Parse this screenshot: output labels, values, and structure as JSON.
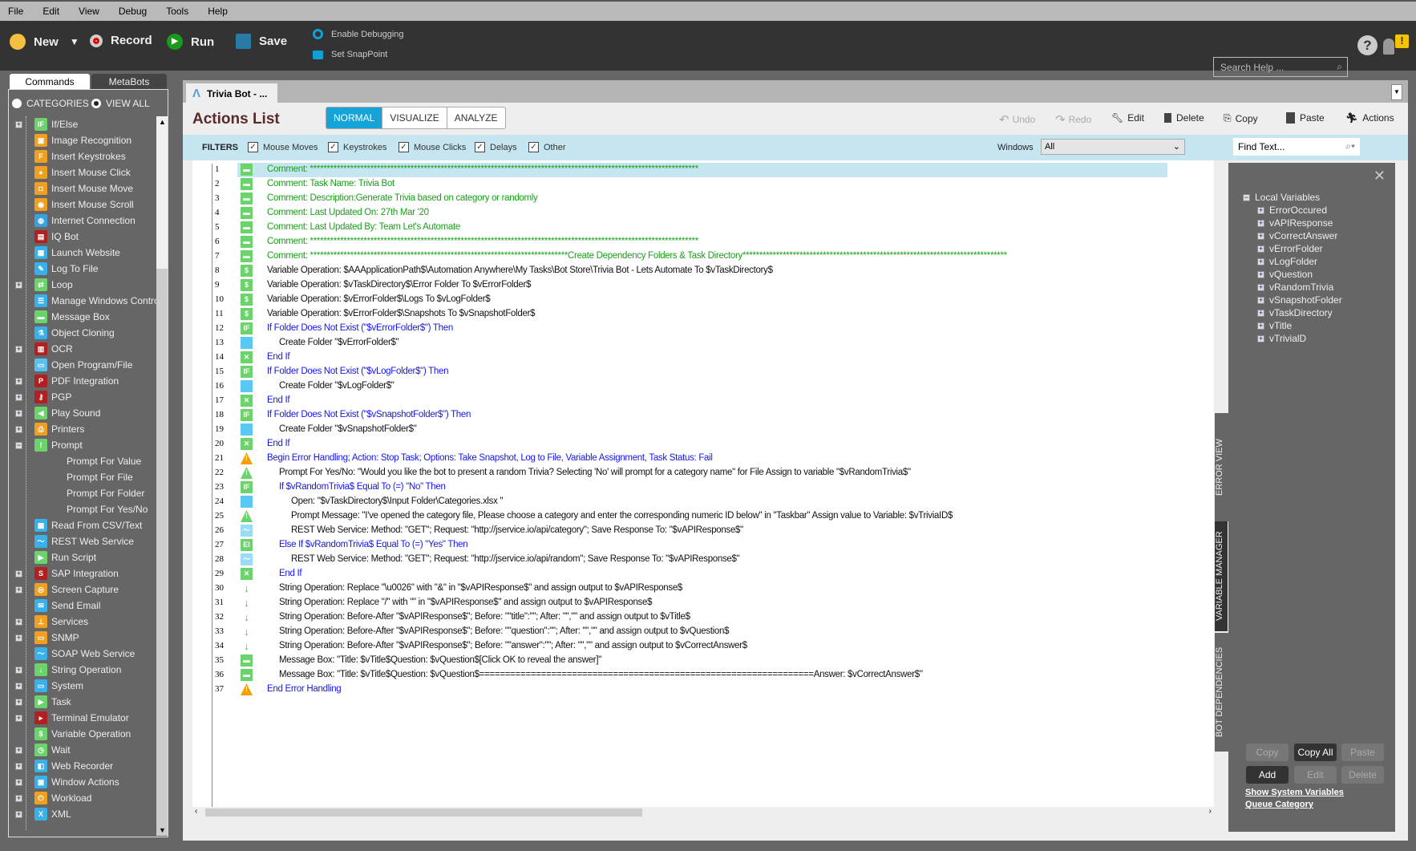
{
  "menu": [
    "File",
    "Edit",
    "View",
    "Debug",
    "Tools",
    "Help"
  ],
  "toolbar": {
    "new": "New",
    "record": "Record",
    "run": "Run",
    "save": "Save",
    "debug": "Enable Debugging",
    "snap": "Set SnapPoint",
    "search_placeholder": "Search Help ..."
  },
  "sidebar": {
    "tabs": [
      "Commands",
      "MetaBots"
    ],
    "categories": "CATEGORIES",
    "view_all": "VIEW ALL",
    "items": [
      {
        "label": "If/Else",
        "exp": "+",
        "icon": "IF",
        "color": "#6cd36c"
      },
      {
        "label": "Image Recognition",
        "icon": "▣",
        "color": "#f0a020"
      },
      {
        "label": "Insert Keystrokes",
        "icon": "F",
        "color": "#f0a020"
      },
      {
        "label": "Insert Mouse Click",
        "icon": "●",
        "color": "#f0a020"
      },
      {
        "label": "Insert Mouse Move",
        "icon": "◘",
        "color": "#f0a020"
      },
      {
        "label": "Insert Mouse Scroll",
        "icon": "◉",
        "color": "#f0a020"
      },
      {
        "label": "Internet Connection",
        "icon": "◍",
        "color": "#3aa0e0"
      },
      {
        "label": "IQ Bot",
        "icon": "▤",
        "color": "#b02020"
      },
      {
        "label": "Launch Website",
        "icon": "▦",
        "color": "#3ab0e8"
      },
      {
        "label": "Log To File",
        "icon": "✎",
        "color": "#3ab0e8"
      },
      {
        "label": "Loop",
        "exp": "+",
        "icon": "⇄",
        "color": "#6cd36c"
      },
      {
        "label": "Manage Windows Controls",
        "icon": "☰",
        "color": "#3ab0e8"
      },
      {
        "label": "Message Box",
        "icon": "▬",
        "color": "#6cd36c"
      },
      {
        "label": "Object Cloning",
        "icon": "⚗",
        "color": "#3ab0e8"
      },
      {
        "label": "OCR",
        "exp": "+",
        "icon": "▥",
        "color": "#b02020"
      },
      {
        "label": "Open Program/File",
        "icon": "▭",
        "color": "#5ac0f0"
      },
      {
        "label": "PDF Integration",
        "exp": "+",
        "icon": "P",
        "color": "#b02020"
      },
      {
        "label": "PGP",
        "exp": "+",
        "icon": "⚷",
        "color": "#b02020"
      },
      {
        "label": "Play Sound",
        "exp": "+",
        "icon": "◀",
        "color": "#6cd36c"
      },
      {
        "label": "Printers",
        "exp": "+",
        "icon": "⎙",
        "color": "#f0a020"
      },
      {
        "label": "Prompt",
        "exp": "−",
        "icon": "!",
        "color": "#6cd36c"
      },
      {
        "label": "Prompt For Value",
        "child": true
      },
      {
        "label": "Prompt For File",
        "child": true
      },
      {
        "label": "Prompt For Folder",
        "child": true
      },
      {
        "label": "Prompt For Yes/No",
        "child": true
      },
      {
        "label": "Read From CSV/Text",
        "icon": "▦",
        "color": "#3ab0e8"
      },
      {
        "label": "REST Web Service",
        "icon": "〜",
        "color": "#3ab0e8"
      },
      {
        "label": "Run Script",
        "icon": "▶",
        "color": "#6cd36c"
      },
      {
        "label": "SAP Integration",
        "exp": "+",
        "icon": "S",
        "color": "#b02020"
      },
      {
        "label": "Screen Capture",
        "exp": "+",
        "icon": "◎",
        "color": "#f0a020"
      },
      {
        "label": "Send Email",
        "icon": "✉",
        "color": "#3ab0e8"
      },
      {
        "label": "Services",
        "exp": "+",
        "icon": "⊥",
        "color": "#f0a020"
      },
      {
        "label": "SNMP",
        "exp": "+",
        "icon": "▭",
        "color": "#f0a020"
      },
      {
        "label": "SOAP Web Service",
        "icon": "〜",
        "color": "#3ab0e8"
      },
      {
        "label": "String Operation",
        "exp": "+",
        "icon": "↓",
        "color": "#6cd36c"
      },
      {
        "label": "System",
        "exp": "+",
        "icon": "▭",
        "color": "#3ab0e8"
      },
      {
        "label": "Task",
        "exp": "+",
        "icon": "▶",
        "color": "#6cd36c"
      },
      {
        "label": "Terminal Emulator",
        "exp": "+",
        "icon": "▸",
        "color": "#b02020"
      },
      {
        "label": "Variable Operation",
        "icon": "$",
        "color": "#6cd36c"
      },
      {
        "label": "Wait",
        "exp": "+",
        "icon": "◷",
        "color": "#6cd36c"
      },
      {
        "label": "Web Recorder",
        "exp": "+",
        "icon": "◧",
        "color": "#3ab0e8"
      },
      {
        "label": "Window Actions",
        "exp": "+",
        "icon": "▣",
        "color": "#3ab0e8"
      },
      {
        "label": "Workload",
        "exp": "+",
        "icon": "⏻",
        "color": "#f0a020"
      },
      {
        "label": "XML",
        "exp": "+",
        "icon": "X",
        "color": "#3ab0e8"
      }
    ]
  },
  "doc_tab": "Trivia Bot - ...",
  "actions": {
    "title": "Actions List",
    "views": [
      "NORMAL",
      "VISUALIZE",
      "ANALYZE"
    ],
    "undo": "Undo",
    "redo": "Redo",
    "edit": "Edit",
    "delete": "Delete",
    "copy": "Copy",
    "paste": "Paste",
    "actions": "Actions"
  },
  "filters": {
    "label": "FILTERS",
    "items": [
      "Mouse Moves",
      "Keystrokes",
      "Mouse Clicks",
      "Delays",
      "Other"
    ],
    "windows_label": "Windows",
    "windows_value": "All",
    "find_placeholder": "Find Text..."
  },
  "lines": [
    {
      "t": "Comment: ********************************************************************************************************************",
      "i": "cm",
      "c": "green",
      "d": 0
    },
    {
      "t": "Comment: Task Name: Trivia Bot",
      "i": "cm",
      "c": "green",
      "d": 0
    },
    {
      "t": "Comment: Description:Generate Trivia based on category or randomly",
      "i": "cm",
      "c": "green",
      "d": 0
    },
    {
      "t": "Comment: Last Updated On: 27th Mar '20",
      "i": "cm",
      "c": "green",
      "d": 0
    },
    {
      "t": "Comment: Last Updated By: Team Let's Automate",
      "i": "cm",
      "c": "green",
      "d": 0
    },
    {
      "t": "Comment: ********************************************************************************************************************",
      "i": "cm",
      "c": "green",
      "d": 0
    },
    {
      "t": "Comment: *****************************************************************************Create Dependency Folders & Task Directory*******************************************************************************",
      "i": "cm",
      "c": "green",
      "d": 0
    },
    {
      "t": "Variable Operation: $AAApplicationPath$\\Automation Anywhere\\My Tasks\\Bot Store\\Trivia Bot - Lets Automate To $vTaskDirectory$",
      "i": "var",
      "c": "black",
      "d": 0
    },
    {
      "t": "Variable Operation: $vTaskDirectory$\\Error Folder To $vErrorFolder$",
      "i": "var",
      "c": "black",
      "d": 0
    },
    {
      "t": "Variable Operation: $vErrorFolder$\\Logs To $vLogFolder$",
      "i": "var",
      "c": "black",
      "d": 0
    },
    {
      "t": "Variable Operation: $vErrorFolder$\\Snapshots To $vSnapshotFolder$",
      "i": "var",
      "c": "black",
      "d": 0
    },
    {
      "t": "If Folder Does Not Exist (\"$vErrorFolder$\")  Then",
      "i": "if",
      "c": "blue",
      "d": 0
    },
    {
      "t": "Create Folder \"$vErrorFolder$\"",
      "i": "fold",
      "c": "black",
      "d": 1
    },
    {
      "t": "End If",
      "i": "endif",
      "c": "blue",
      "d": 0
    },
    {
      "t": "If Folder Does Not Exist (\"$vLogFolder$\")  Then",
      "i": "if",
      "c": "blue",
      "d": 0
    },
    {
      "t": "Create Folder \"$vLogFolder$\"",
      "i": "fold",
      "c": "black",
      "d": 1
    },
    {
      "t": "End If",
      "i": "endif",
      "c": "blue",
      "d": 0
    },
    {
      "t": "If Folder Does Not Exist (\"$vSnapshotFolder$\")  Then",
      "i": "if",
      "c": "blue",
      "d": 0
    },
    {
      "t": "Create Folder \"$vSnapshotFolder$\"",
      "i": "fold",
      "c": "black",
      "d": 1
    },
    {
      "t": "End If",
      "i": "endif",
      "c": "blue",
      "d": 0
    },
    {
      "t": "Begin Error Handling; Action: Stop Task; Options: Take Snapshot, Log to File, Variable Assignment,  Task Status: Fail",
      "i": "warn",
      "c": "blue",
      "d": 0
    },
    {
      "t": "Prompt For Yes/No: \"Would you like the bot to present a random Trivia? Selecting 'No' will prompt for a category name\" for File Assign to variable \"$vRandomTrivia$\"",
      "i": "prompt",
      "c": "black",
      "d": 1
    },
    {
      "t": "If $vRandomTrivia$ Equal To (=) \"No\" Then",
      "i": "if",
      "c": "blue",
      "d": 1
    },
    {
      "t": "Open: \"$vTaskDirectory$\\Input Folder\\Categories.xlsx \"",
      "i": "open",
      "c": "black",
      "d": 2
    },
    {
      "t": "Prompt Message: \"I've opened the category file, Please choose a category and enter the corresponding numeric ID below\" in \"Taskbar\" Assign value to Variable: $vTriviaID$",
      "i": "prompt",
      "c": "black",
      "d": 2
    },
    {
      "t": "REST Web Service: Method: \"GET\"; Request: \"http://jservice.io/api/category\"; Save Response To: \"$vAPIResponse$\"",
      "i": "rest",
      "c": "black",
      "d": 2
    },
    {
      "t": "Else If $vRandomTrivia$ Equal To (=) \"Yes\" Then",
      "i": "elif",
      "c": "blue",
      "d": 1
    },
    {
      "t": "REST Web Service: Method: \"GET\"; Request: \"http://jservice.io/api/random\"; Save Response To: \"$vAPIResponse$\"",
      "i": "rest",
      "c": "black",
      "d": 2
    },
    {
      "t": "End If",
      "i": "endif",
      "c": "blue",
      "d": 1
    },
    {
      "t": "String Operation: Replace \"\\u0026\" with \"&\" in \"$vAPIResponse$\" and assign output to $vAPIResponse$",
      "i": "str",
      "c": "black",
      "d": 1
    },
    {
      "t": "String Operation: Replace \"/\" with \"\" in \"$vAPIResponse$\" and assign output to $vAPIResponse$",
      "i": "str",
      "c": "black",
      "d": 1
    },
    {
      "t": "String Operation: Before-After \"$vAPIResponse$\"; Before: \"\"title\":\"\"; After: \"\",\"\" and assign output to $vTitle$",
      "i": "str",
      "c": "black",
      "d": 1
    },
    {
      "t": "String Operation: Before-After \"$vAPIResponse$\"; Before: \"\"question\":\"\"; After: \"\",\"\" and assign output to $vQuestion$",
      "i": "str",
      "c": "black",
      "d": 1
    },
    {
      "t": "String Operation: Before-After \"$vAPIResponse$\"; Before: \"\"answer\":\"\"; After: \"\",\"\" and assign output to $vCorrectAnswer$",
      "i": "str",
      "c": "black",
      "d": 1
    },
    {
      "t": "Message Box: \"Title: $vTitle$Question: $vQuestion$[Click OK to reveal the answer]\"",
      "i": "msg",
      "c": "black",
      "d": 1
    },
    {
      "t": "Message Box: \"Title: $vTitle$Question: $vQuestion$=================================================================Answer: $vCorrectAnswer$\"",
      "i": "msg",
      "c": "black",
      "d": 1
    },
    {
      "t": "End Error Handling",
      "i": "warn",
      "c": "blue",
      "d": 0
    }
  ],
  "side_tabs": [
    "ERROR VIEW",
    "VARIABLE MANAGER",
    "BOT DEPENDENCIES"
  ],
  "variables": {
    "root": "Local Variables",
    "items": [
      "ErrorOccured",
      "vAPIResponse",
      "vCorrectAnswer",
      "vErrorFolder",
      "vLogFolder",
      "vQuestion",
      "vRandomTrivia",
      "vSnapshotFolder",
      "vTaskDirectory",
      "vTitle",
      "vTrivialD"
    ],
    "buttons": [
      "Copy",
      "Copy All",
      "Paste",
      "Add",
      "Edit",
      "Delete"
    ],
    "show_system": "Show System Variables",
    "queue": "Queue Category"
  },
  "colors": {
    "accent": "#16a4d8",
    "comment": "#18a018",
    "keyword": "#1515f0"
  }
}
